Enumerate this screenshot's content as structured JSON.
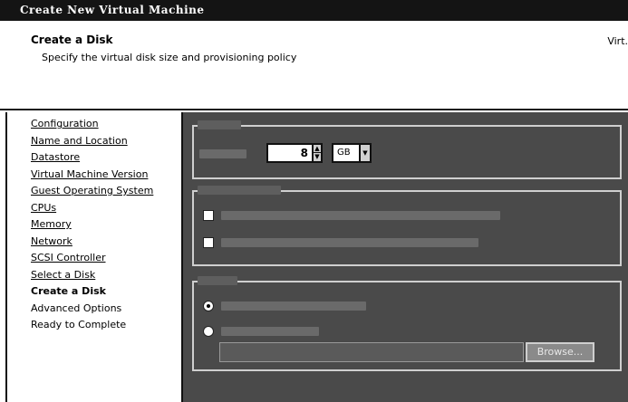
{
  "window": {
    "title": "Create New Virtual Machine"
  },
  "header": {
    "title": "Create a Disk",
    "subtitle": "Specify the virtual disk size and provisioning policy",
    "right_text": "Virt."
  },
  "sidebar": {
    "items": [
      {
        "label": "Configuration",
        "state": "link"
      },
      {
        "label": "Name and Location",
        "state": "link"
      },
      {
        "label": "Datastore",
        "state": "link"
      },
      {
        "label": "Virtual Machine Version",
        "state": "link"
      },
      {
        "label": "Guest Operating System",
        "state": "link"
      },
      {
        "label": "CPUs",
        "state": "link"
      },
      {
        "label": "Memory",
        "state": "link"
      },
      {
        "label": "Network",
        "state": "link"
      },
      {
        "label": "SCSI Controller",
        "state": "link"
      },
      {
        "label": "Select a Disk",
        "state": "link"
      },
      {
        "label": "Create a Disk",
        "state": "current"
      },
      {
        "label": "Advanced Options",
        "state": "pending"
      },
      {
        "label": "Ready to Complete",
        "state": "pending"
      }
    ]
  },
  "capacity": {
    "disk_size_value": "8",
    "unit_value": "GB"
  },
  "location": {
    "browse_label": "Browse..."
  },
  "icons": {
    "spin_up": "▲",
    "spin_down": "▼",
    "dropdown": "▼"
  }
}
